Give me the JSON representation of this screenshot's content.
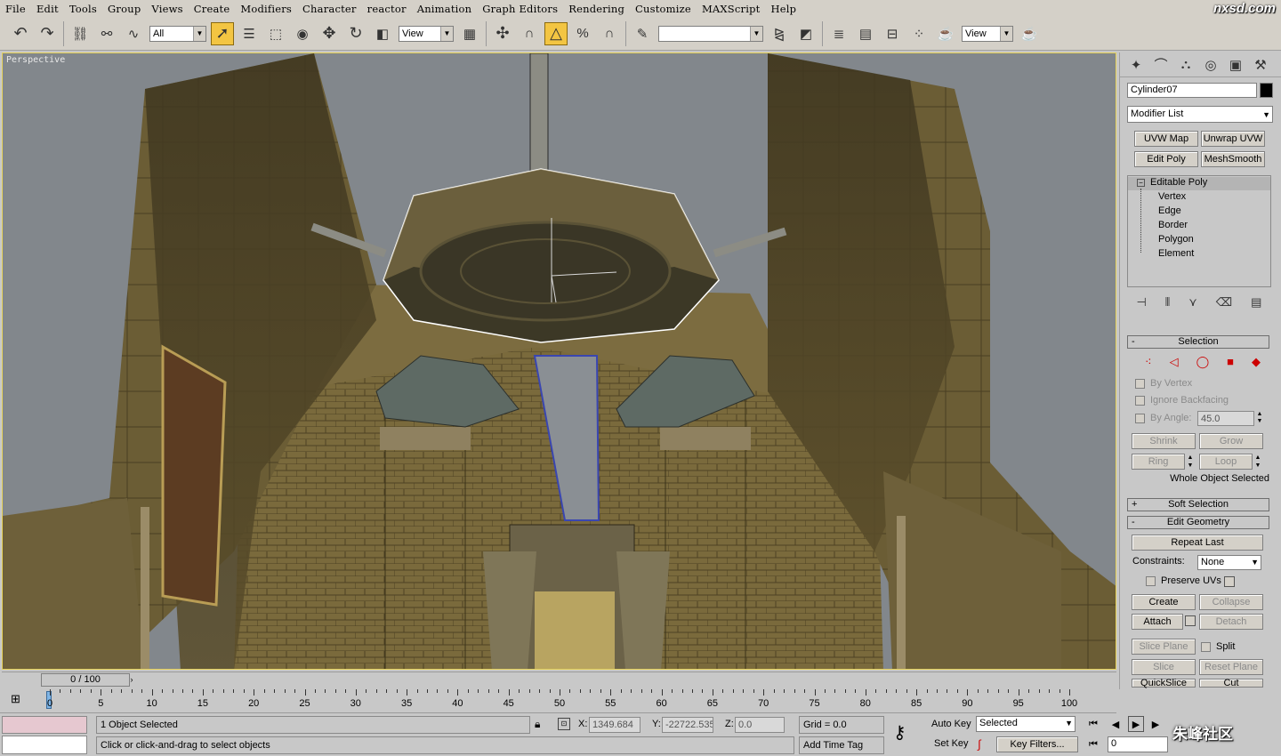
{
  "menu": [
    "File",
    "Edit",
    "Tools",
    "Group",
    "Views",
    "Create",
    "Modifiers",
    "Character",
    "reactor",
    "Animation",
    "Graph Editors",
    "Rendering",
    "Customize",
    "MAXScript",
    "Help"
  ],
  "logo": "nxsd.com",
  "toolbar": {
    "selection_filter": "All",
    "ref_coord": "View",
    "named_selection": "",
    "render_view": "View"
  },
  "viewport": {
    "label": "Perspective"
  },
  "command_panel": {
    "object_name": "Cylinder07",
    "object_color": "#000000",
    "modifier_list": "Modifier List",
    "modifier_buttons": [
      "UVW Map",
      "Unwrap UVW",
      "Edit Poly",
      "MeshSmooth"
    ],
    "stack": {
      "root": "Editable Poly",
      "sub": [
        "Vertex",
        "Edge",
        "Border",
        "Polygon",
        "Element"
      ]
    },
    "selection": {
      "title": "Selection",
      "by_vertex": "By Vertex",
      "ignore_backfacing": "Ignore Backfacing",
      "by_angle": "By Angle:",
      "angle_value": "45.0",
      "shrink": "Shrink",
      "grow": "Grow",
      "ring": "Ring",
      "loop": "Loop",
      "status": "Whole Object Selected"
    },
    "soft_selection": "Soft Selection",
    "edit_geometry": {
      "title": "Edit Geometry",
      "repeat_last": "Repeat Last",
      "constraints_label": "Constraints:",
      "constraints_value": "None",
      "preserve_uvs": "Preserve UVs",
      "create": "Create",
      "collapse": "Collapse",
      "attach": "Attach",
      "detach": "Detach",
      "slice_plane": "Slice Plane",
      "split": "Split",
      "slice": "Slice",
      "reset_plane": "Reset Plane",
      "quickslice": "QuickSlice",
      "cut": "Cut"
    }
  },
  "timeline": {
    "frame_display": "0 / 100",
    "ticks": [
      "0",
      "5",
      "10",
      "15",
      "20",
      "25",
      "30",
      "35",
      "40",
      "45",
      "50",
      "55",
      "60",
      "65",
      "70",
      "75",
      "80",
      "85",
      "90",
      "95",
      "100"
    ]
  },
  "status": {
    "selected": "1 Object Selected",
    "prompt": "Click or click-and-drag to select objects",
    "x_label": "X:",
    "x_value": "1349.684",
    "y_label": "Y:",
    "y_value": "-22722.535",
    "z_label": "Z:",
    "z_value": "0.0",
    "grid": "Grid = 0.0",
    "add_time_tag": "Add Time Tag",
    "auto_key": "Auto Key",
    "set_key": "Set Key",
    "selected_dd": "Selected",
    "key_filters": "Key Filters...",
    "frame": "0"
  },
  "watermark": "朱峰社区"
}
